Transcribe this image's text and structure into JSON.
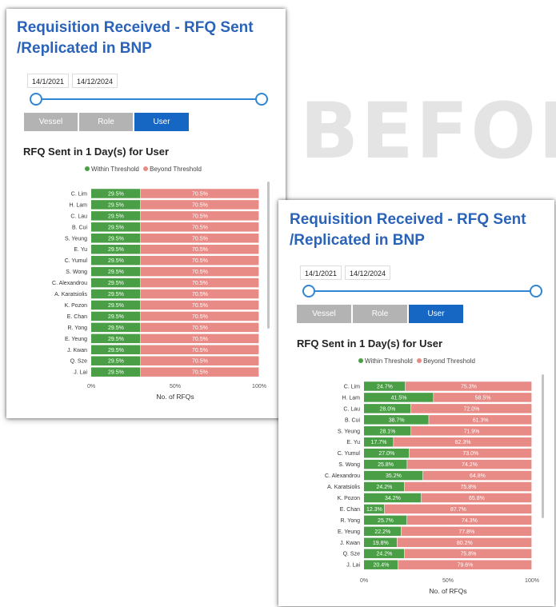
{
  "watermark": "BEFORE",
  "colors": {
    "within": "#4a9e45",
    "beyond": "#e88a85",
    "title_blue": "#2a63b8",
    "active_button": "#1666c4",
    "inactive_button": "#b3b3b3"
  },
  "panels": [
    {
      "title_line1": "Requisition Received - RFQ Sent",
      "title_line2": "/Replicated in BNP",
      "date_start": "14/1/2021",
      "date_end": "14/12/2024",
      "buttons": [
        "Vessel",
        "Role",
        "User"
      ],
      "active_button": "User",
      "chart_title": "RFQ Sent in 1 Day(s) for User",
      "legend": [
        "Within Threshold",
        "Beyond Threshold"
      ]
    },
    {
      "title_line1": "Requisition Received - RFQ Sent",
      "title_line2": "/Replicated in BNP",
      "date_start": "14/1/2021",
      "date_end": "14/12/2024",
      "buttons": [
        "Vessel",
        "Role",
        "User"
      ],
      "active_button": "User",
      "chart_title": "RFQ Sent in 1 Day(s) for User",
      "legend": [
        "Within Threshold",
        "Beyond Threshold"
      ]
    }
  ],
  "chart_data": [
    {
      "type": "bar",
      "orientation": "horizontal",
      "stacked": "100%",
      "title": "RFQ Sent in 1 Day(s) for User",
      "xlabel": "No. of RFQs",
      "ylabel": "",
      "xlim": [
        0,
        100
      ],
      "x_ticks": [
        "0%",
        "50%",
        "100%"
      ],
      "legend_position": "top",
      "categories": [
        "C. Lim",
        "H. Lam",
        "C. Lau",
        "B. Cui",
        "S. Yeung",
        "E. Yu",
        "C. Yumul",
        "S. Wong",
        "C. Alexandrou",
        "A. Karatsiolis",
        "K. Pozon",
        "E. Chan",
        "R. Yong",
        "E. Yeung",
        "J. Kwan",
        "Q. Sze",
        "J. Lai"
      ],
      "series": [
        {
          "name": "Within Threshold",
          "color": "#4a9e45",
          "values": [
            29.5,
            29.5,
            29.5,
            29.5,
            29.5,
            29.5,
            29.5,
            29.5,
            29.5,
            29.5,
            29.5,
            29.5,
            29.5,
            29.5,
            29.5,
            29.5,
            29.5
          ]
        },
        {
          "name": "Beyond Threshold",
          "color": "#e88a85",
          "values": [
            70.5,
            70.5,
            70.5,
            70.5,
            70.5,
            70.5,
            70.5,
            70.5,
            70.5,
            70.5,
            70.5,
            70.5,
            70.5,
            70.5,
            70.5,
            70.5,
            70.5
          ]
        }
      ]
    },
    {
      "type": "bar",
      "orientation": "horizontal",
      "stacked": "100%",
      "title": "RFQ Sent in 1 Day(s) for User",
      "xlabel": "No. of RFQs",
      "ylabel": "",
      "xlim": [
        0,
        100
      ],
      "x_ticks": [
        "0%",
        "50%",
        "100%"
      ],
      "legend_position": "top",
      "categories": [
        "C. Lim",
        "H. Lam",
        "C. Lau",
        "B. Cui",
        "S. Yeung",
        "E. Yu",
        "C. Yumul",
        "S. Wong",
        "C. Alexandrou",
        "A. Karatsiolis",
        "K. Pozon",
        "E. Chan",
        "R. Yong",
        "E. Yeung",
        "J. Kwan",
        "Q. Sze",
        "J. Lai"
      ],
      "series": [
        {
          "name": "Within Threshold",
          "color": "#4a9e45",
          "values": [
            24.7,
            41.5,
            28.0,
            38.7,
            28.1,
            17.7,
            27.0,
            25.8,
            35.2,
            24.2,
            34.2,
            12.3,
            25.7,
            22.2,
            19.8,
            24.2,
            20.4
          ]
        },
        {
          "name": "Beyond Threshold",
          "color": "#e88a85",
          "values": [
            75.3,
            58.5,
            72.0,
            61.3,
            71.9,
            82.3,
            73.0,
            74.2,
            64.8,
            75.8,
            65.8,
            87.7,
            74.3,
            77.8,
            80.2,
            75.8,
            79.6
          ]
        }
      ]
    }
  ]
}
